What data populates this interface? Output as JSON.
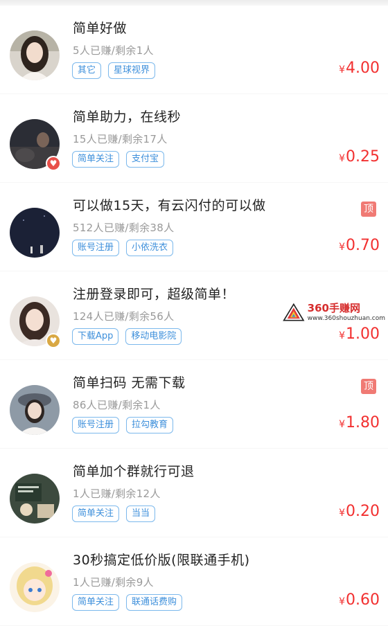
{
  "tasks": [
    {
      "title": "简单好做",
      "stats": "5人已赚/剩余1人",
      "tags": [
        "其它",
        "星球视界"
      ],
      "price": "4.00",
      "pinned": false,
      "badge": null
    },
    {
      "title": "简单助力，在线秒",
      "stats": "15人已赚/剩余17人",
      "tags": [
        "简单关注",
        "支付宝"
      ],
      "price": "0.25",
      "pinned": false,
      "badge": "red"
    },
    {
      "title": "可以做15天，有云闪付的可以做",
      "stats": "512人已赚/剩余38人",
      "tags": [
        "账号注册",
        "小依洗衣"
      ],
      "price": "0.70",
      "pinned": true,
      "badge": null
    },
    {
      "title": "注册登录即可，超级简单！",
      "stats": "124人已赚/剩余56人",
      "tags": [
        "下载App",
        "移动电影院"
      ],
      "price": "1.00",
      "pinned": false,
      "badge": "gold"
    },
    {
      "title": "简单扫码 无需下载",
      "stats": "86人已赚/剩余1人",
      "tags": [
        "账号注册",
        "拉勾教育"
      ],
      "price": "1.80",
      "pinned": true,
      "badge": null
    },
    {
      "title": "简单加个群就行可退",
      "stats": "1人已赚/剩余12人",
      "tags": [
        "简单关注",
        "当当"
      ],
      "price": "0.20",
      "pinned": false,
      "badge": null
    },
    {
      "title": "30秒搞定低价版(限联通手机)",
      "stats": "1人已赚/剩余9人",
      "tags": [
        "简单关注",
        "联通话费购"
      ],
      "price": "0.60",
      "pinned": false,
      "badge": null
    }
  ],
  "labels": {
    "currency": "¥",
    "pinned_badge": "顶"
  },
  "watermark": {
    "title": "360手赚网",
    "url": "www.360shouzhuan.com"
  },
  "colors": {
    "price": "#f23030",
    "tag_text": "#3d8fdb",
    "tag_border": "#7bb8ec",
    "pin": "#f07a74",
    "badge_red": "#e8504a",
    "badge_gold": "#d9a843"
  },
  "icons": {
    "badge_red": "heart-icon",
    "badge_gold": "heart-icon",
    "watermark": "triangle-logo-icon"
  }
}
